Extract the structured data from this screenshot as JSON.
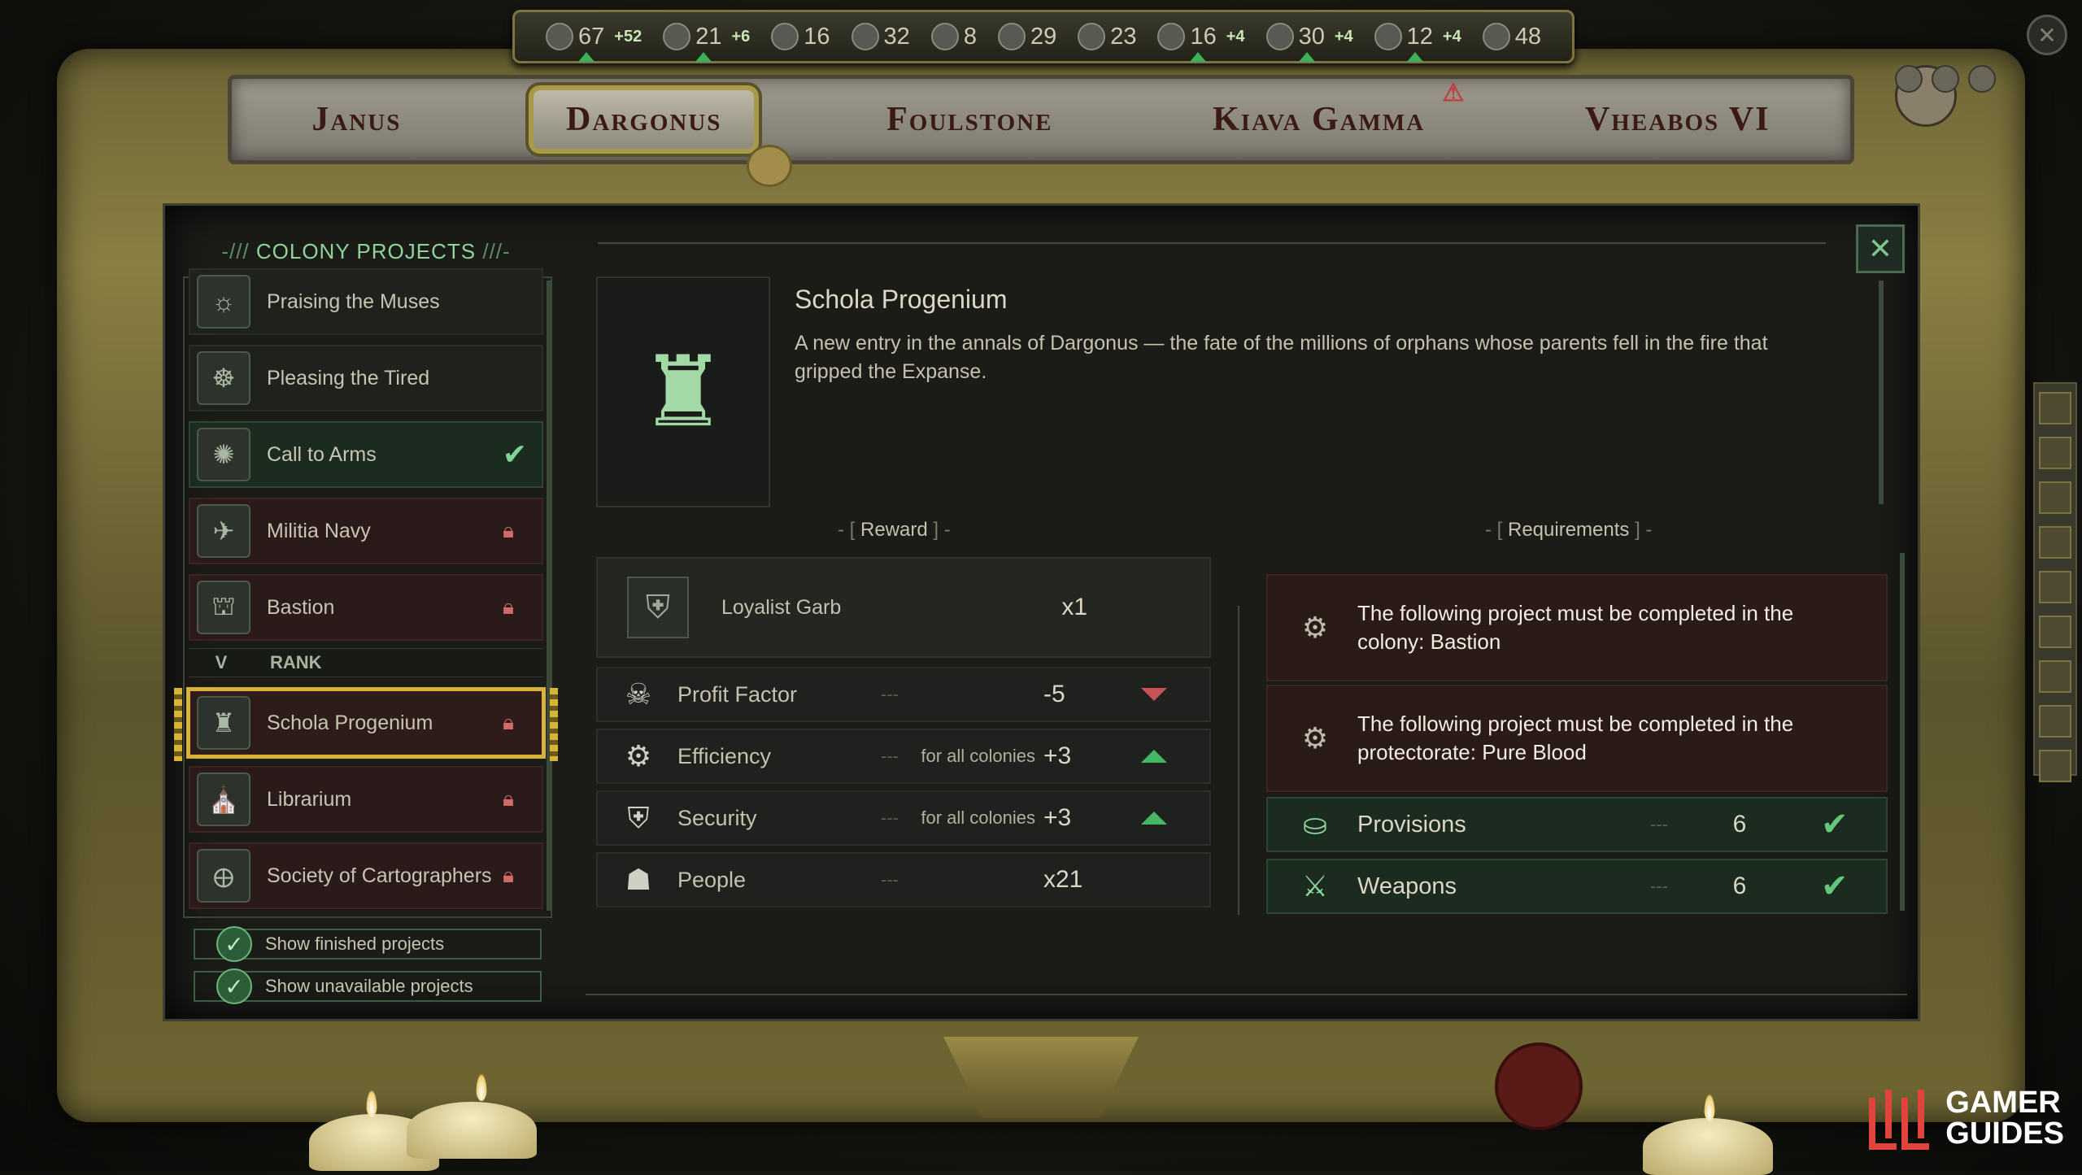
{
  "resources": [
    {
      "icon": "coin-icon",
      "value": "67",
      "delta": "+52",
      "up": true
    },
    {
      "icon": "supply-icon",
      "value": "21",
      "delta": "+6",
      "up": true
    },
    {
      "icon": "people-icon",
      "value": "16",
      "delta": "",
      "up": false
    },
    {
      "icon": "document-icon",
      "value": "32",
      "delta": "",
      "up": false
    },
    {
      "icon": "gear-icon",
      "value": "8",
      "delta": "",
      "up": false
    },
    {
      "icon": "crate-icon",
      "value": "29",
      "delta": "",
      "up": false
    },
    {
      "icon": "rifle-icon",
      "value": "23",
      "delta": "",
      "up": false
    },
    {
      "icon": "ore-icon",
      "value": "16",
      "delta": "+4",
      "up": true
    },
    {
      "icon": "ration-icon",
      "value": "30",
      "delta": "+4",
      "up": true
    },
    {
      "icon": "plant-icon",
      "value": "12",
      "delta": "+4",
      "up": true
    },
    {
      "icon": "cog-icon",
      "value": "48",
      "delta": "",
      "up": false
    }
  ],
  "tabs": [
    {
      "label": "Janus",
      "active": false,
      "alert": false
    },
    {
      "label": "Dargonus",
      "active": true,
      "alert": false
    },
    {
      "label": "Foulstone",
      "active": false,
      "alert": false
    },
    {
      "label": "Kiava Gamma",
      "active": false,
      "alert": true
    },
    {
      "label": "Vheabos VI",
      "active": false,
      "alert": false
    }
  ],
  "panel": {
    "list_title": "COLONY PROJECTS",
    "projects": [
      {
        "name": "Praising the Muses",
        "state": "normal"
      },
      {
        "name": "Pleasing the Tired",
        "state": "normal"
      },
      {
        "name": "Call to Arms",
        "state": "available"
      },
      {
        "name": "Militia Navy",
        "state": "locked"
      },
      {
        "name": "Bastion",
        "state": "locked"
      }
    ],
    "rank": {
      "numeral": "V",
      "label": "RANK"
    },
    "projects_rank": [
      {
        "name": "Schola Progenium",
        "state": "selected"
      },
      {
        "name": "Librarium",
        "state": "locked"
      },
      {
        "name": "Society of Cartographers",
        "state": "locked"
      }
    ],
    "toggles": [
      {
        "label": "Show finished projects",
        "checked": true
      },
      {
        "label": "Show unavailable projects",
        "checked": true
      }
    ]
  },
  "detail": {
    "title": "Schola Progenium",
    "description": "A new entry in the annals of Dargonus — the fate of the millions of orphans whose parents fell in the fire that gripped the Expanse.",
    "reward_label": "Reward",
    "requirements_label": "Requirements",
    "reward_item": {
      "name": "Loyalist Garb",
      "qty": "x1"
    },
    "stats": [
      {
        "icon": "profit-icon",
        "label": "Profit Factor",
        "dash": "---",
        "scope": "",
        "value": "-5",
        "trend": "down"
      },
      {
        "icon": "efficiency-icon",
        "label": "Efficiency",
        "dash": "---",
        "scope": "for all colonies",
        "value": "+3",
        "trend": "up"
      },
      {
        "icon": "security-icon",
        "label": "Security",
        "dash": "---",
        "scope": "for all colonies",
        "value": "+3",
        "trend": "up"
      },
      {
        "icon": "people-icon",
        "label": "People",
        "dash": "---",
        "scope": "",
        "value": "x21",
        "trend": ""
      }
    ],
    "requirements": [
      {
        "text": "The following project must be completed in the colony: Bastion"
      },
      {
        "text": "The following project must be completed in the protectorate: Pure Blood"
      }
    ],
    "req_resources": [
      {
        "icon": "provisions-icon",
        "name": "Provisions",
        "dash": "---",
        "value": "6"
      },
      {
        "icon": "weapons-icon",
        "name": "Weapons",
        "dash": "---",
        "value": "6"
      }
    ]
  },
  "watermark": {
    "line1": "GAMER",
    "line2": "GUIDES"
  },
  "colors": {
    "accent_green": "#8ed39a",
    "locked_red": "#d36a6a",
    "selected_gold": "#d8b338"
  }
}
